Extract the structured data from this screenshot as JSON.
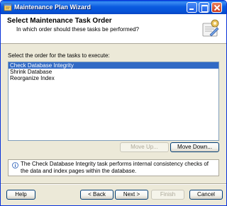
{
  "window": {
    "title": "Maintenance Plan Wizard"
  },
  "header": {
    "title": "Select Maintenance Task Order",
    "subtitle": "In which order should these tasks be performed?"
  },
  "prompt": "Select the order for the tasks to execute:",
  "tasks": {
    "items": [
      "Check Database Integrity",
      "Shrink Database",
      "Reorganize Index"
    ],
    "selected": 0
  },
  "buttons": {
    "move_up": "Move Up...",
    "move_down": "Move Down...",
    "help": "Help",
    "back": "< Back",
    "next": "Next >",
    "finish": "Finish",
    "cancel": "Cancel"
  },
  "info": {
    "text": "The Check Database Integrity task performs internal consistency checks of the data and index pages within the database."
  },
  "colors": {
    "titlebar": "#0b5be0",
    "selection": "#316ac5",
    "dialog_bg": "#ece9d8"
  },
  "icons": {
    "title": "wizard-app-icon",
    "header": "wizard-gear-icon",
    "info": "info-icon"
  }
}
